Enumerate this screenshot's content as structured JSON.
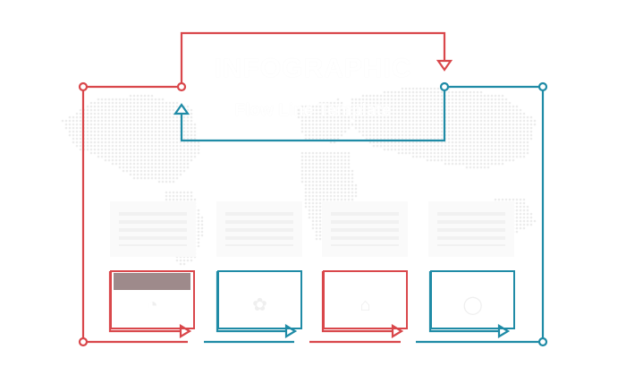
{
  "title": "INFOGRAPHIC",
  "subtitle": "Flow Line Template",
  "colors": {
    "red": "#d9474b",
    "teal": "#1f8ba6",
    "map": "#ececec",
    "banner": "#9e8a8b"
  },
  "steps": [
    {
      "label": "",
      "icon": "clock-icon",
      "color": "red"
    },
    {
      "label": "",
      "icon": "leaf-icon",
      "color": "teal"
    },
    {
      "label": "",
      "icon": "house-icon",
      "color": "red"
    },
    {
      "label": "",
      "icon": "globe-icon",
      "color": "teal"
    }
  ]
}
